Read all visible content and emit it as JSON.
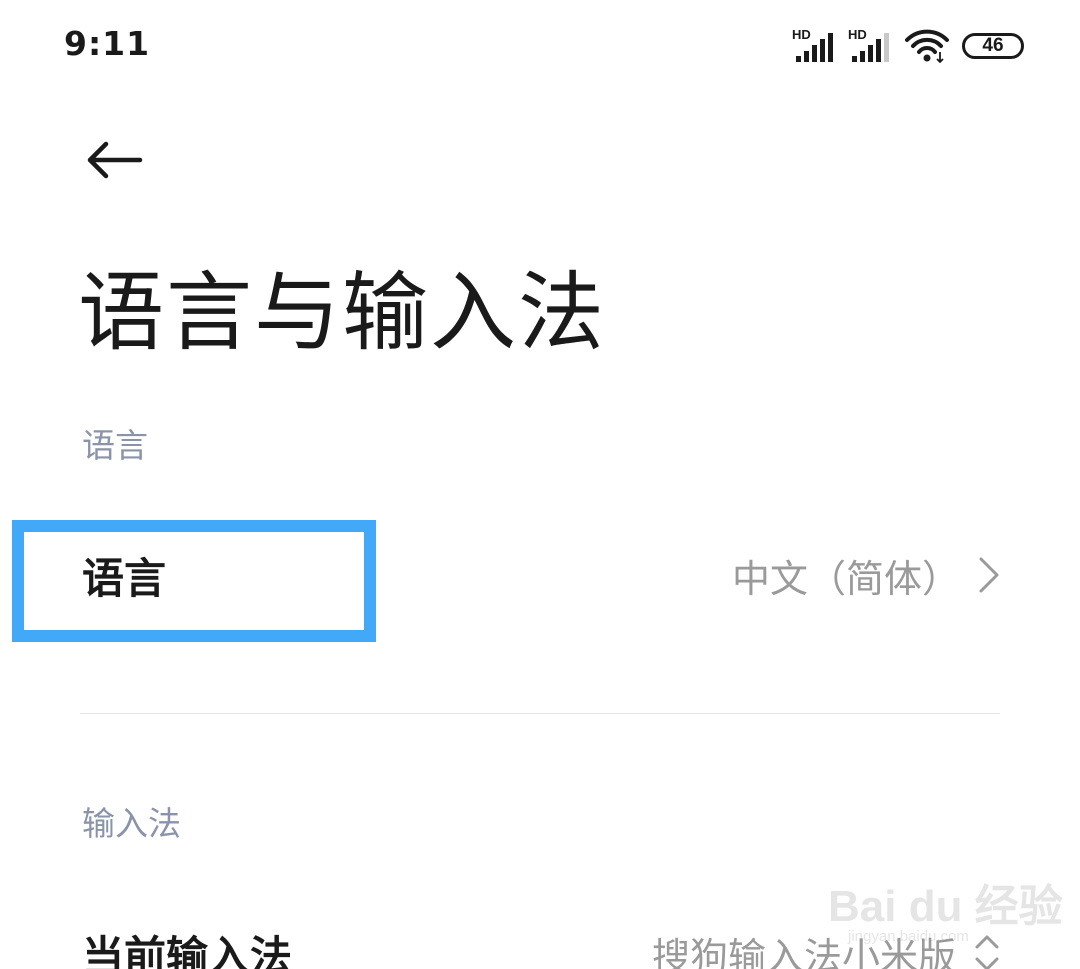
{
  "status_bar": {
    "time": "9:11",
    "signal_1_label": "HD",
    "signal_2_label": "HD",
    "battery_level": "46",
    "icons": [
      "signal-hd-icon",
      "signal-hd-icon",
      "wifi-icon",
      "battery-icon"
    ]
  },
  "header": {
    "back_icon": "arrow-left-icon",
    "title": "语言与输入法"
  },
  "sections": {
    "language": {
      "header": "语言",
      "item_label": "语言",
      "item_value": "中文（简体）"
    },
    "input_method": {
      "header": "输入法",
      "item_label": "当前输入法",
      "item_value": "搜狗输入法小米版"
    }
  },
  "watermark": {
    "text": "Bai du 经验",
    "sub": "jingyan.baidu.com"
  },
  "colors": {
    "highlight": "#42a9f8",
    "section_header": "#8a93a8",
    "value_text": "#9a9a9a"
  }
}
